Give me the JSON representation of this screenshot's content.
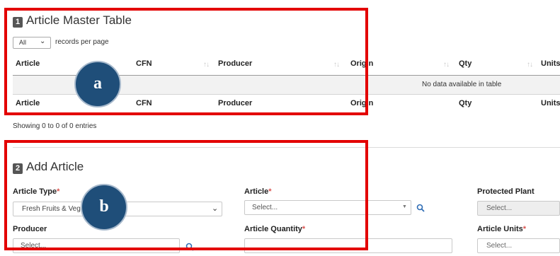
{
  "master": {
    "num": "1",
    "title": "Article Master Table",
    "length_value": "All",
    "length_suffix": "records per page",
    "columns": [
      "Article",
      "CFN",
      "Producer",
      "Origin",
      "Qty",
      "Units"
    ],
    "empty_message": "No data available in table",
    "info": "Showing 0 to 0 of 0 entries"
  },
  "add": {
    "num": "2",
    "title": "Add Article",
    "article_type_label": "Article Type",
    "article_type_value": "Fresh Fruits & Vegetables",
    "article_label": "Article",
    "article_placeholder": "Select...",
    "protected_plant_label": "Protected Plant",
    "protected_plant_placeholder": "Select...",
    "producer_label": "Producer",
    "producer_placeholder": "Select...",
    "article_quantity_label": "Article Quantity",
    "article_units_label": "Article Units",
    "article_units_placeholder": "Select...",
    "required_mark": "*"
  },
  "annotations": {
    "a": "a",
    "b": "b"
  },
  "colors": {
    "highlight": "#e30000",
    "circle_fill": "#1f4e79",
    "required": "#d9534f"
  }
}
